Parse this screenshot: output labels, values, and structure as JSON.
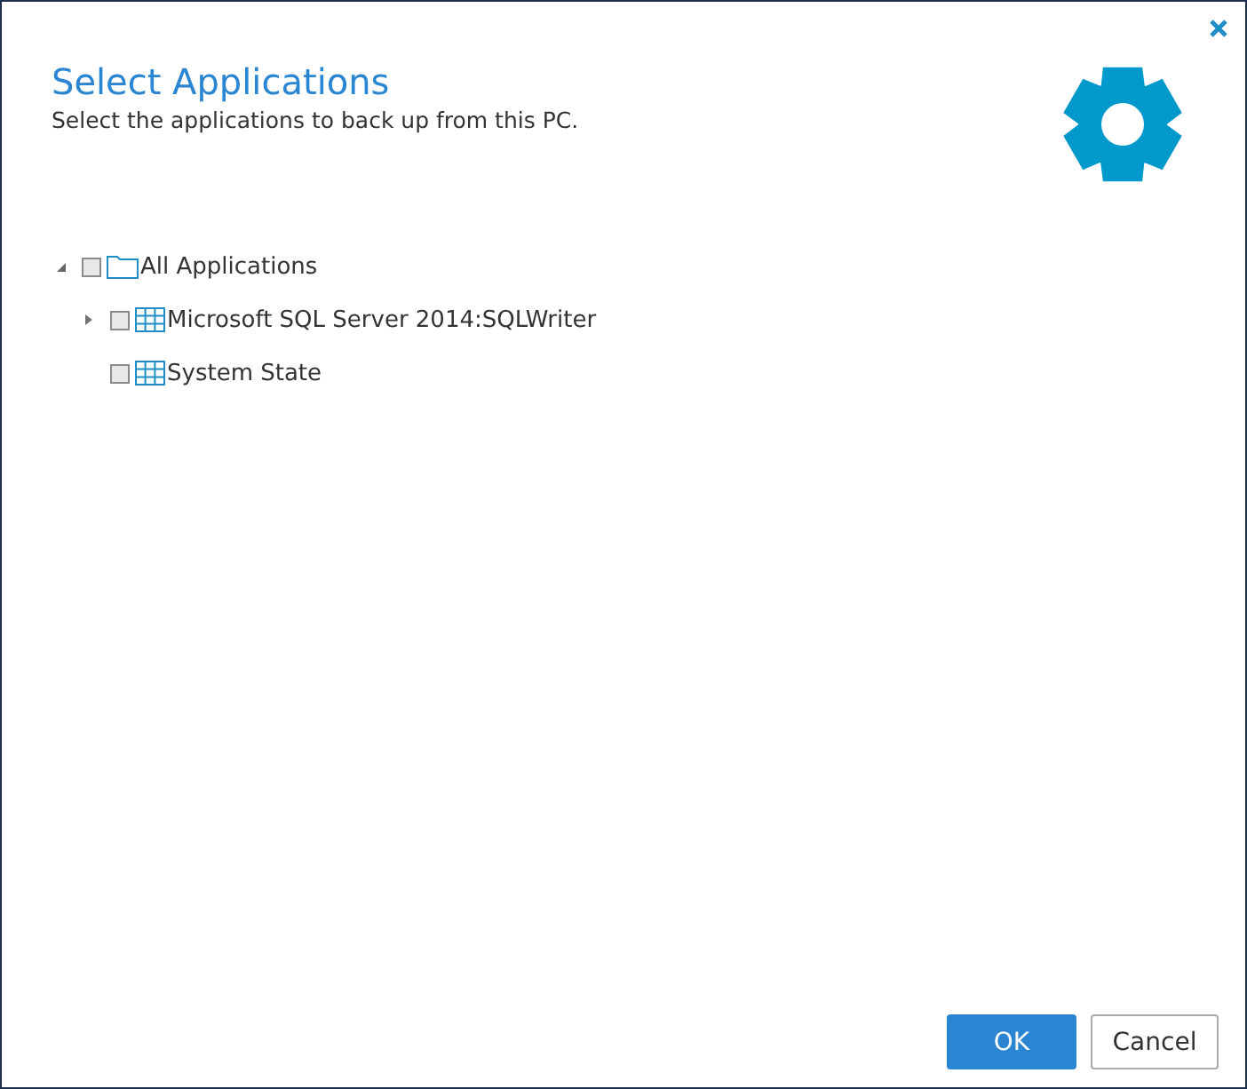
{
  "dialog": {
    "title": "Select Applications",
    "subtitle": "Select the applications to back up from this PC."
  },
  "tree": [
    {
      "label": "All Applications",
      "kind": "folder",
      "checked": false,
      "expanded": true,
      "children": [
        {
          "label": "Microsoft SQL Server 2014:SQLWriter",
          "kind": "table",
          "checked": false,
          "expanded": false
        },
        {
          "label": "System State",
          "kind": "table",
          "checked": false
        }
      ]
    }
  ],
  "buttons": [
    {
      "label": "OK",
      "kind": "primary"
    },
    {
      "label": "Cancel",
      "kind": "secondary"
    }
  ]
}
